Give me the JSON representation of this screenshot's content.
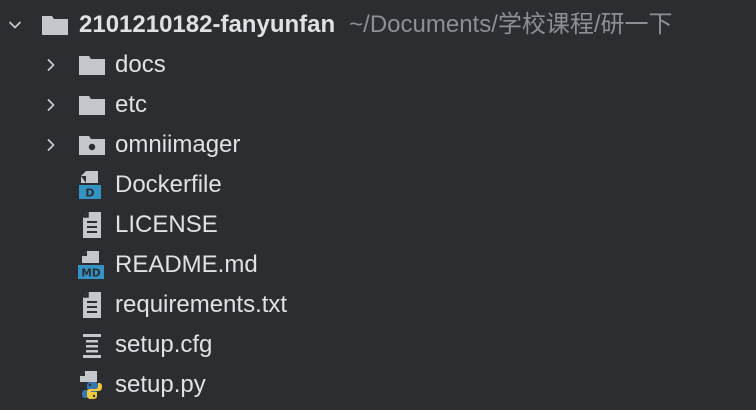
{
  "root": {
    "name": "2101210182-fanyunfan",
    "path": "~/Documents/学校课程/研一下",
    "expanded": true
  },
  "items": [
    {
      "label": "docs",
      "type": "folder",
      "icon": "folder-icon"
    },
    {
      "label": "etc",
      "type": "folder",
      "icon": "folder-icon"
    },
    {
      "label": "omniimager",
      "type": "folder",
      "icon": "package-folder-icon"
    },
    {
      "label": "Dockerfile",
      "type": "file",
      "icon": "dockerfile-icon"
    },
    {
      "label": "LICENSE",
      "type": "file",
      "icon": "text-file-icon"
    },
    {
      "label": "README.md",
      "type": "file",
      "icon": "markdown-file-icon"
    },
    {
      "label": "requirements.txt",
      "type": "file",
      "icon": "text-file-icon"
    },
    {
      "label": "setup.cfg",
      "type": "file",
      "icon": "config-file-icon"
    },
    {
      "label": "setup.py",
      "type": "file",
      "icon": "python-file-icon"
    }
  ],
  "colors": {
    "background": "#2b2d30",
    "text": "#dfe1e5",
    "path_text": "#8c8f94",
    "icon_gray": "#c5c7cc",
    "docker_blue": "#3592c4",
    "python_blue": "#3a75b0",
    "python_yellow": "#f0c93d"
  }
}
